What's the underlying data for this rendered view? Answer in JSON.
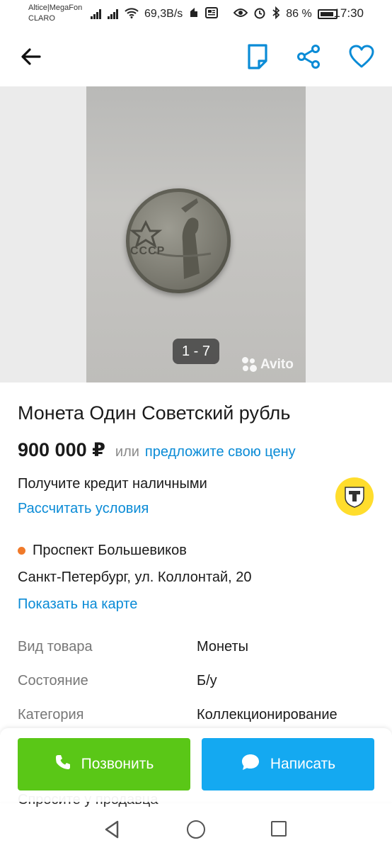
{
  "status_bar": {
    "carrier_1": "Altice|MegaFon",
    "carrier_2": "CLARO",
    "speed": "69,3B/s",
    "battery": "86 %",
    "time": "17:30"
  },
  "app_bar": {
    "back_icon": "arrow-left-icon",
    "note_icon": "note-icon",
    "share_icon": "share-icon",
    "favorite_icon": "heart-icon"
  },
  "gallery": {
    "counter": "1 - 7",
    "watermark": "Avito",
    "coin_text": "СССР"
  },
  "listing": {
    "title": "Монета Один Советский рубль",
    "price": "900 000 ₽",
    "or_text": "или",
    "offer_link": "предложите свою цену"
  },
  "credit": {
    "text": "Получите кредит наличными",
    "link": "Рассчитать условия"
  },
  "location": {
    "metro": "Проспект Большевиков",
    "address": "Санкт-Петербург, ул. Коллонтай, 20",
    "map_link": "Показать на карте"
  },
  "params": [
    {
      "label": "Вид товара",
      "value": "Монеты"
    },
    {
      "label": "Состояние",
      "value": "Б/у"
    },
    {
      "label": "Категория",
      "value": "Коллекционирование"
    }
  ],
  "ask_seller": "Спросите у продавца",
  "actions": {
    "call": "Позвонить",
    "write": "Написать"
  },
  "colors": {
    "link": "#0a8bd6",
    "call_button": "#5ac717",
    "write_button": "#14a9f1",
    "metro_dot": "#f07a2a",
    "bank_logo": "#ffdd2d"
  }
}
